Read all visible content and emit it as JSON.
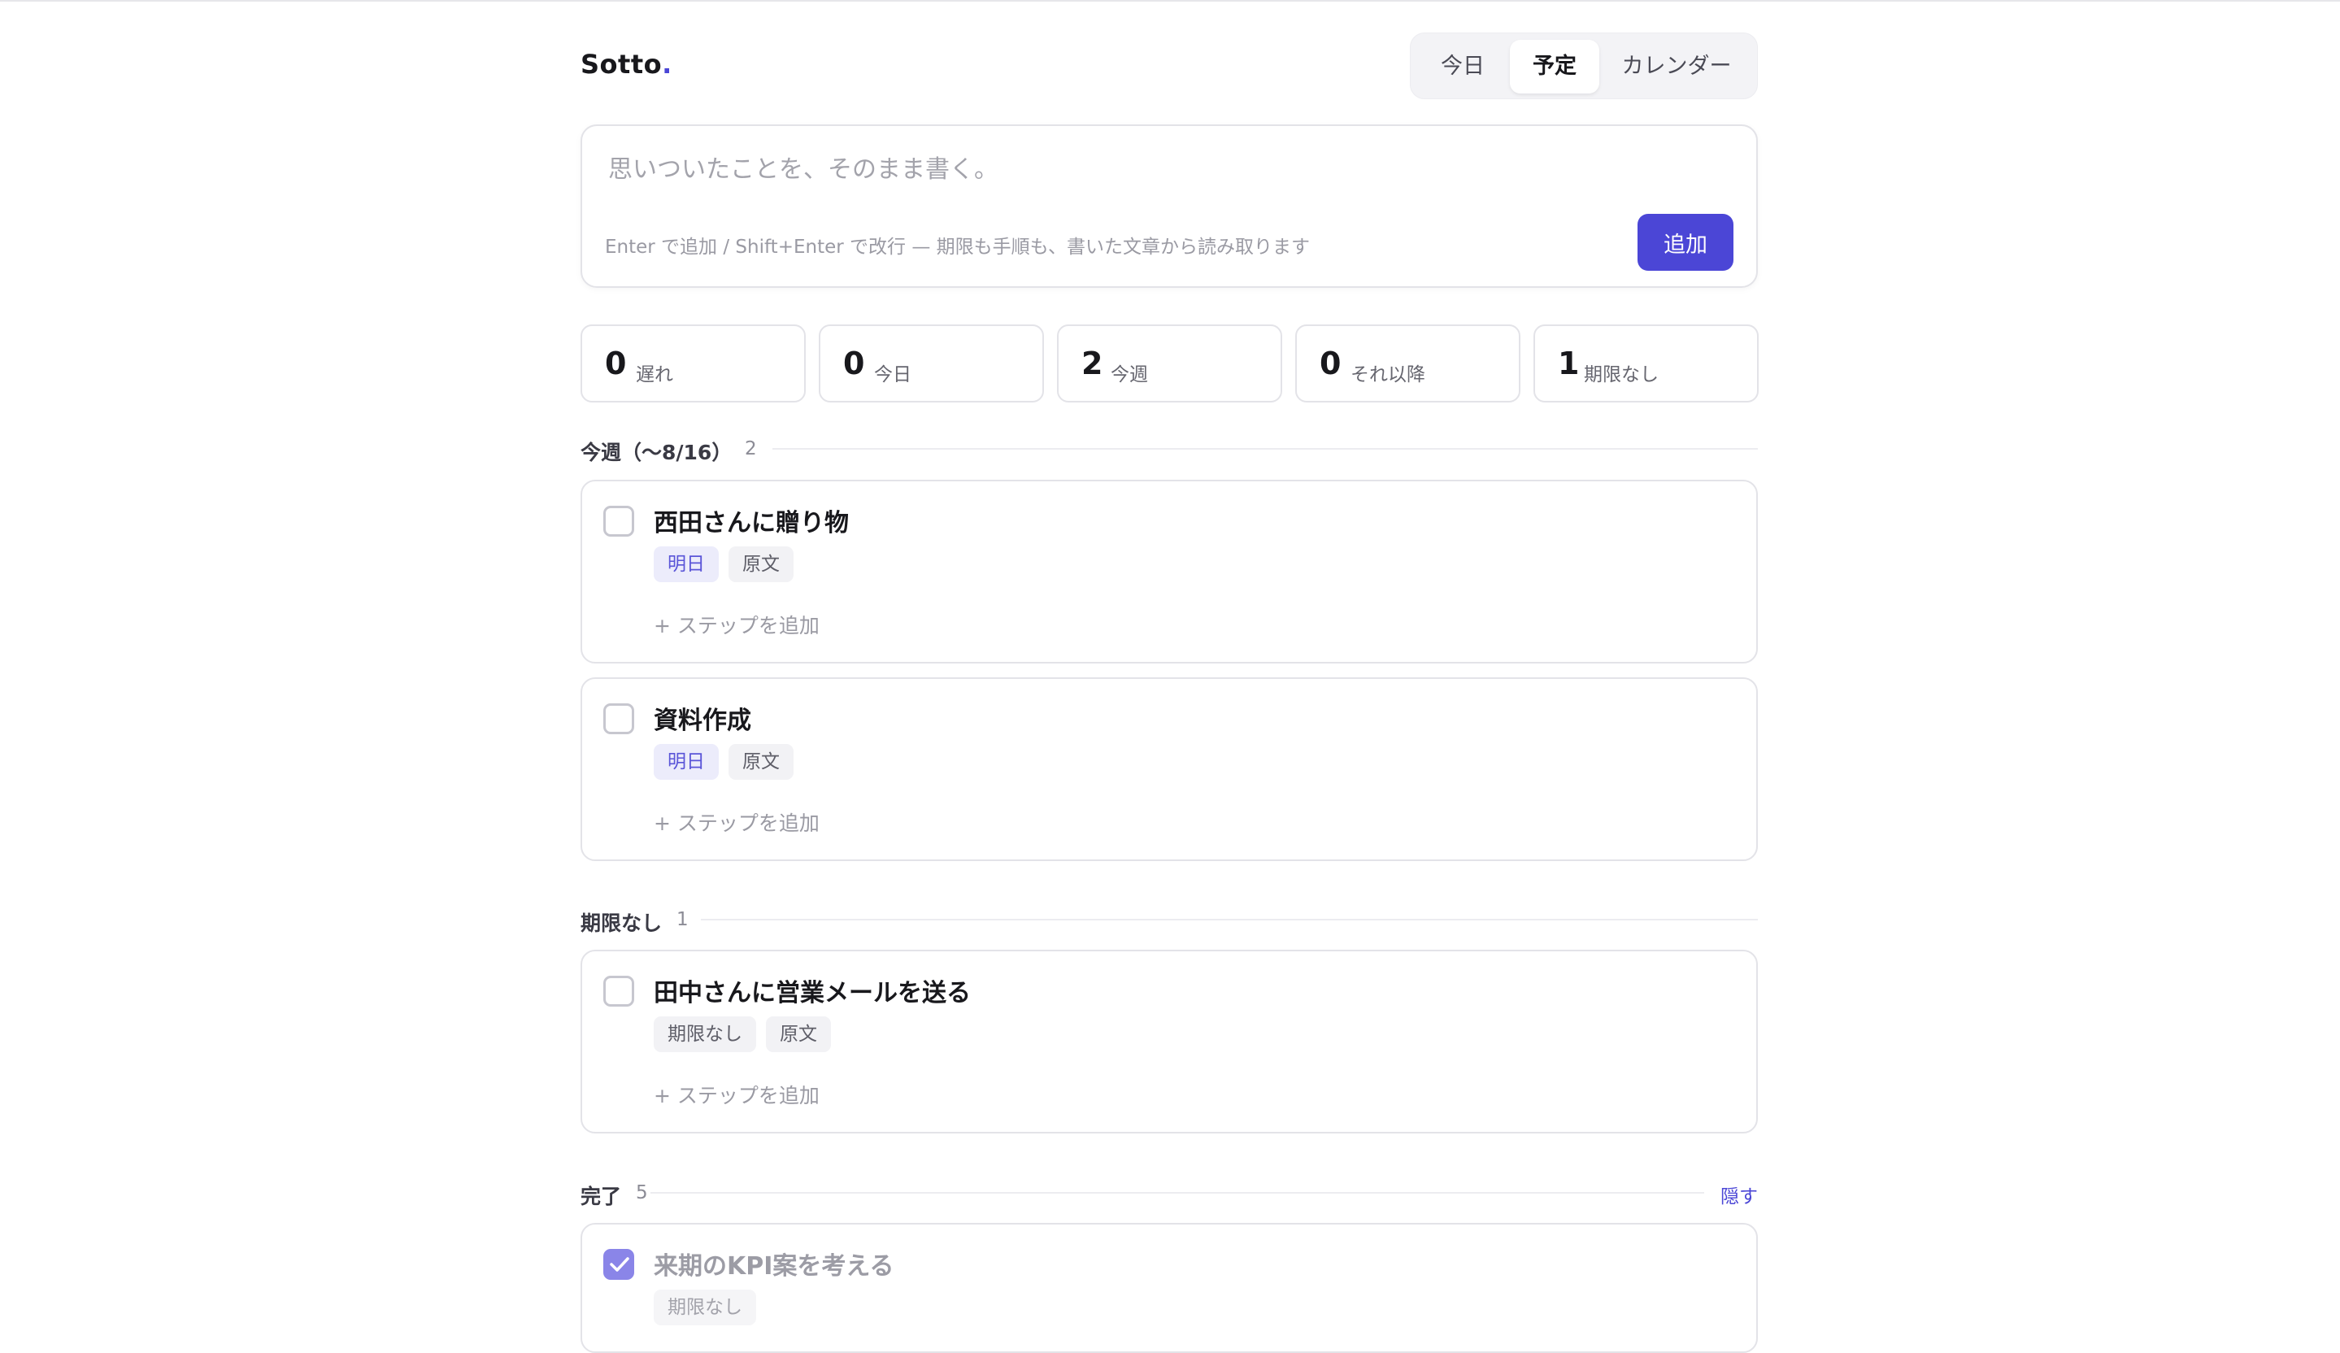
{
  "app": {
    "name": "Sotto",
    "name_dot": "."
  },
  "tabs": [
    {
      "label": "今日",
      "active": false
    },
    {
      "label": "予定",
      "active": true
    },
    {
      "label": "カレンダー",
      "active": false
    }
  ],
  "composer": {
    "placeholder": "思いついたことを、そのまま書く。",
    "hint": "Enter で追加 / Shift+Enter で改行 — 期限も手順も、書いた文章から読み取ります",
    "add_label": "追加"
  },
  "stats": [
    {
      "count": "0",
      "label": "遅れ"
    },
    {
      "count": "0",
      "label": "今日"
    },
    {
      "count": "2",
      "label": "今週"
    },
    {
      "count": "0",
      "label": "それ以降"
    },
    {
      "count": "1",
      "label": "期限なし"
    }
  ],
  "sections": {
    "this_week": {
      "title": "今週（〜8/16）",
      "count": "2",
      "tasks": [
        {
          "title": "西田さんに贈り物",
          "tags": [
            "明日",
            "原文"
          ],
          "add_step": "+ ステップを追加"
        },
        {
          "title": "資料作成",
          "tags": [
            "明日",
            "原文"
          ],
          "add_step": "+ ステップを追加"
        }
      ]
    },
    "no_deadline": {
      "title": "期限なし",
      "count": "1",
      "tasks": [
        {
          "title": "田中さんに営業メールを送る",
          "tags": [
            "期限なし",
            "原文"
          ],
          "add_step": "+ ステップを追加"
        }
      ]
    },
    "done": {
      "title": "完了",
      "count": "5",
      "toggle_label": "隠す",
      "tasks": [
        {
          "title": "来期のKPI案を考える",
          "tags": [
            "期限なし"
          ]
        }
      ]
    }
  },
  "colors": {
    "accent": "#4b46d6",
    "accent_soft": "#ececfb",
    "border": "#e3e3e8"
  }
}
